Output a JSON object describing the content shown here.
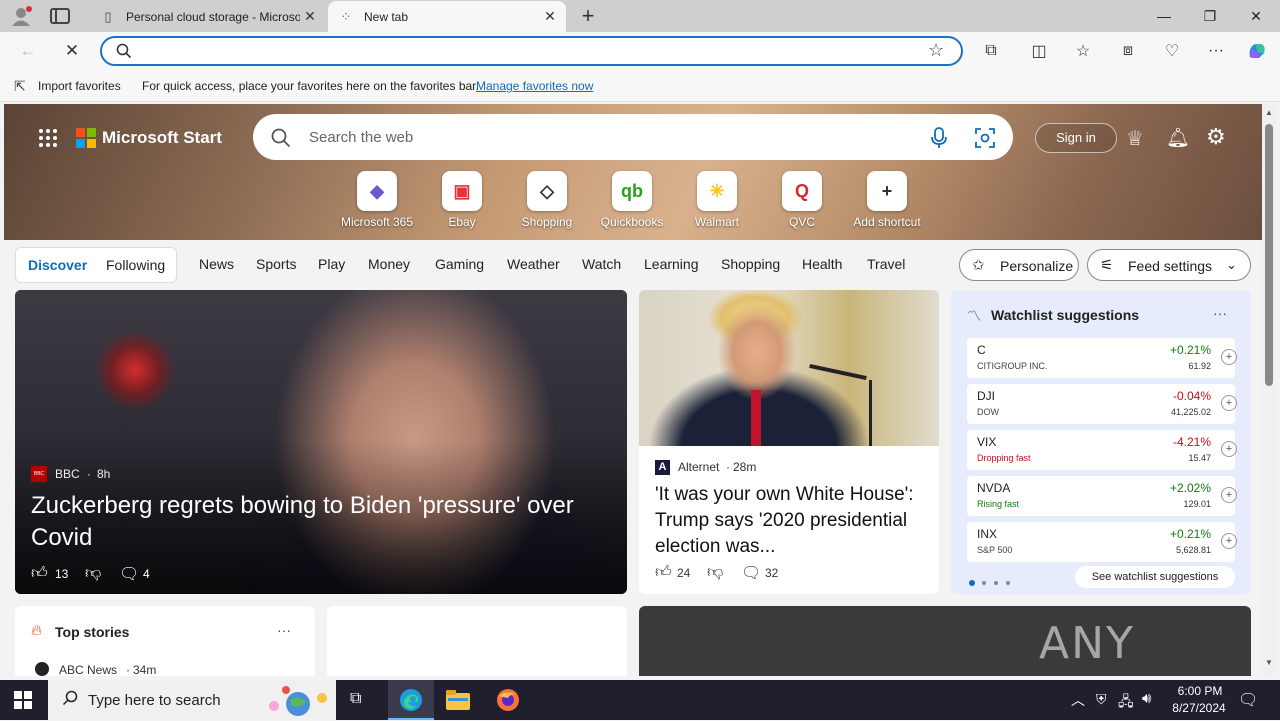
{
  "tabs": [
    {
      "title": "Personal cloud storage - Microsof",
      "active": false
    },
    {
      "title": "New tab",
      "active": true
    }
  ],
  "new_tab_symbol": "+",
  "window_controls": {
    "minimize": "—",
    "restore": "❐",
    "close": "✕"
  },
  "address_bar": {
    "value": "",
    "placeholder": ""
  },
  "favorites_bar": {
    "import_label": "Import favorites",
    "message": "For quick access, place your favorites here on the favorites bar.",
    "manage_link": "Manage favorites now"
  },
  "msn": {
    "brand": "Microsoft Start",
    "search_placeholder": "Search the web",
    "sign_in": "Sign in",
    "shortcuts": [
      {
        "label": "Microsoft 365",
        "glyph": "◆",
        "color": "#6a5acd"
      },
      {
        "label": "Ebay",
        "glyph": "▣",
        "color": "#e53238"
      },
      {
        "label": "Shopping",
        "glyph": "◇",
        "color": "#333333"
      },
      {
        "label": "Quickbooks",
        "glyph": "qb",
        "color": "#2ca01c"
      },
      {
        "label": "Walmart",
        "glyph": "✳",
        "color": "#ffc220"
      },
      {
        "label": "QVC",
        "glyph": "Q",
        "color": "#d9272e"
      },
      {
        "label": "Add shortcut",
        "glyph": "+",
        "color": "#333333"
      }
    ],
    "nav": {
      "discover": "Discover",
      "following": "Following",
      "items": [
        "News",
        "Sports",
        "Play",
        "Money",
        "Gaming",
        "Weather",
        "Watch",
        "Learning",
        "Shopping",
        "Health",
        "Travel"
      ],
      "personalize": "Personalize",
      "feed_settings": "Feed settings"
    },
    "main_story": {
      "source": "BBC",
      "source_badge": "BBC",
      "age": "8h",
      "headline": "Zuckerberg regrets bowing to Biden 'pressure' over Covid",
      "likes": "13",
      "comments": "4"
    },
    "second_story": {
      "source": "Alternet",
      "age": "28m",
      "headline": "'It was your own White House': Trump says '2020 presidential election was...",
      "likes": "24",
      "comments": "32"
    },
    "watchlist": {
      "title": "Watchlist suggestions",
      "menu": "···",
      "rows": [
        {
          "symbol": "C",
          "name": "CITIGROUP INC.",
          "change": "+0.21%",
          "price": "61.92",
          "up": true
        },
        {
          "symbol": "DJI",
          "name": "DOW",
          "change": "-0.04%",
          "price": "41,225.02",
          "up": false
        },
        {
          "symbol": "VIX",
          "name": "Dropping fast",
          "change": "-4.21%",
          "price": "15.47",
          "up": false
        },
        {
          "symbol": "NVDA",
          "name": "Rising fast",
          "change": "+2.02%",
          "price": "129.01",
          "up": true
        },
        {
          "symbol": "INX",
          "name": "S&P 500",
          "change": "+0.21%",
          "price": "5,628.81",
          "up": true
        }
      ],
      "see_more": "See watchlist suggestions"
    },
    "top_stories": {
      "title": "Top stories",
      "menu": "···",
      "first_source": "ABC News",
      "first_age": "34m"
    },
    "watermark": "ANY RUN"
  },
  "taskbar": {
    "search_placeholder": "Type here to search",
    "time": "6:00 PM",
    "date": "8/27/2024"
  },
  "colors": {
    "accent": "#0f6cbd",
    "positive": "#107c10",
    "negative": "#c50f1f"
  }
}
